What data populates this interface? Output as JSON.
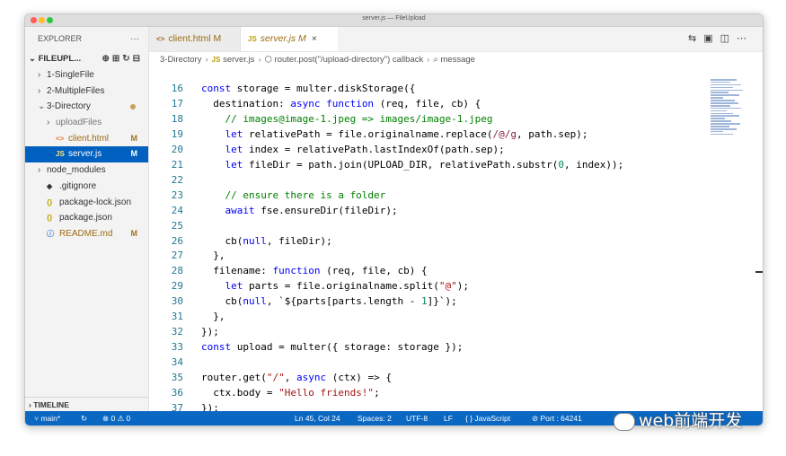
{
  "window": {
    "title": "server.js — FileUpload"
  },
  "explorer": {
    "header": "EXPLORER",
    "more": "···",
    "project": "FILEUPL...",
    "project_actions": "⊕⊞↻⊟",
    "items": [
      {
        "chev": "›",
        "icon": "",
        "label": "1-SingleFile",
        "badge": "",
        "indent": 1
      },
      {
        "chev": "›",
        "icon": "",
        "label": "2-MultipleFiles",
        "badge": "",
        "indent": 1
      },
      {
        "chev": "⌄",
        "icon": "",
        "label": "3-Directory",
        "badge": "dot",
        "indent": 1
      },
      {
        "chev": "›",
        "icon": "",
        "label": "uploadFiles",
        "badge": "",
        "indent": 2
      },
      {
        "chev": "",
        "icon": "<>",
        "label": "client.html",
        "badge": "M",
        "indent": 2
      },
      {
        "chev": "",
        "icon": "JS",
        "label": "server.js",
        "badge": "M",
        "indent": 2
      },
      {
        "chev": "›",
        "icon": "",
        "label": "node_modules",
        "badge": "",
        "indent": 1
      },
      {
        "chev": "",
        "icon": "◆",
        "label": ".gitignore",
        "badge": "",
        "indent": 1
      },
      {
        "chev": "",
        "icon": "{}",
        "label": "package-lock.json",
        "badge": "",
        "indent": 1
      },
      {
        "chev": "",
        "icon": "{}",
        "label": "package.json",
        "badge": "",
        "indent": 1
      },
      {
        "chev": "",
        "icon": "ⓘ",
        "label": "README.md",
        "badge": "M",
        "indent": 1
      }
    ],
    "timeline": "TIMELINE"
  },
  "tabs": [
    {
      "icon": "<>",
      "label": "client.html",
      "badge": "M"
    },
    {
      "icon": "JS",
      "label": "server.js",
      "badge": "M",
      "close": "×"
    }
  ],
  "tab_actions": "⇆▣◫⋯",
  "breadcrumbs": [
    "3-Directory",
    "JS",
    "server.js",
    "router.post(\"/upload-directory\") callback",
    "message"
  ],
  "code": {
    "start": 16,
    "lines": [
      [
        [
          "const ",
          "k"
        ],
        [
          "storage = multer.diskStorage({",
          "p"
        ]
      ],
      [
        [
          "  destination: ",
          "p"
        ],
        [
          "async function ",
          "k"
        ],
        [
          "(req, file, cb) {",
          "p"
        ]
      ],
      [
        [
          "    // images@image-1.jpeg => images/image-1.jpeg",
          "c"
        ]
      ],
      [
        [
          "    ",
          "p"
        ],
        [
          "let ",
          "k"
        ],
        [
          "relativePath = file.originalname.replace(",
          "p"
        ],
        [
          "/@/g",
          "r"
        ],
        [
          ", path.sep);",
          "p"
        ]
      ],
      [
        [
          "    ",
          "p"
        ],
        [
          "let ",
          "k"
        ],
        [
          "index = relativePath.lastIndexOf(path.sep);",
          "p"
        ]
      ],
      [
        [
          "    ",
          "p"
        ],
        [
          "let ",
          "k"
        ],
        [
          "fileDir = path.join(UPLOAD_DIR, relativePath.substr(",
          "p"
        ],
        [
          "0",
          "n"
        ],
        [
          ", index));",
          "p"
        ]
      ],
      [
        [
          "",
          "p"
        ]
      ],
      [
        [
          "    // ensure there is a folder",
          "c"
        ]
      ],
      [
        [
          "    ",
          "p"
        ],
        [
          "await ",
          "k"
        ],
        [
          "fse.ensureDir(fileDir);",
          "p"
        ]
      ],
      [
        [
          "",
          "p"
        ]
      ],
      [
        [
          "    cb(",
          "p"
        ],
        [
          "null",
          "k"
        ],
        [
          ", fileDir);",
          "p"
        ]
      ],
      [
        [
          "  },",
          "p"
        ]
      ],
      [
        [
          "  filename: ",
          "p"
        ],
        [
          "function ",
          "k"
        ],
        [
          "(req, file, cb) {",
          "p"
        ]
      ],
      [
        [
          "    ",
          "p"
        ],
        [
          "let ",
          "k"
        ],
        [
          "parts = file.originalname.split(",
          "p"
        ],
        [
          "\"@\"",
          "s"
        ],
        [
          ");",
          "p"
        ]
      ],
      [
        [
          "    cb(",
          "p"
        ],
        [
          "null",
          "k"
        ],
        [
          ", `${parts[parts.length - ",
          "p"
        ],
        [
          "1",
          "n"
        ],
        [
          "]}`);",
          "p"
        ]
      ],
      [
        [
          "  },",
          "p"
        ]
      ],
      [
        [
          "});",
          "p"
        ]
      ],
      [
        [
          "const ",
          "k"
        ],
        [
          "upload = multer({ storage: storage });",
          "p"
        ]
      ],
      [
        [
          "",
          "p"
        ]
      ],
      [
        [
          "router.get(",
          "p"
        ],
        [
          "\"/\"",
          "s"
        ],
        [
          ", ",
          "p"
        ],
        [
          "async ",
          "k"
        ],
        [
          "(ctx) => {",
          "p"
        ]
      ],
      [
        [
          "  ctx.body = ",
          "p"
        ],
        [
          "\"Hello friends!\"",
          "s"
        ],
        [
          ";",
          "p"
        ]
      ],
      [
        [
          "});",
          "p"
        ]
      ]
    ]
  },
  "status": {
    "branch": "main*",
    "sync": "↻",
    "problems": "⊗ 0 ⚠ 0",
    "position": "Ln 45, Col 24",
    "spaces": "Spaces: 2",
    "encoding": "UTF-8",
    "eol": "LF",
    "language": "{ } JavaScript",
    "port": "⊘ Port : 64241"
  },
  "watermark": "web前端开发",
  "colors": {
    "keyword": "#0000ff",
    "comment": "#008000",
    "string": "#a31515",
    "number": "#098658",
    "regex": "#811f3f",
    "accent": "#0a67c2",
    "modified": "#9c6b12"
  }
}
